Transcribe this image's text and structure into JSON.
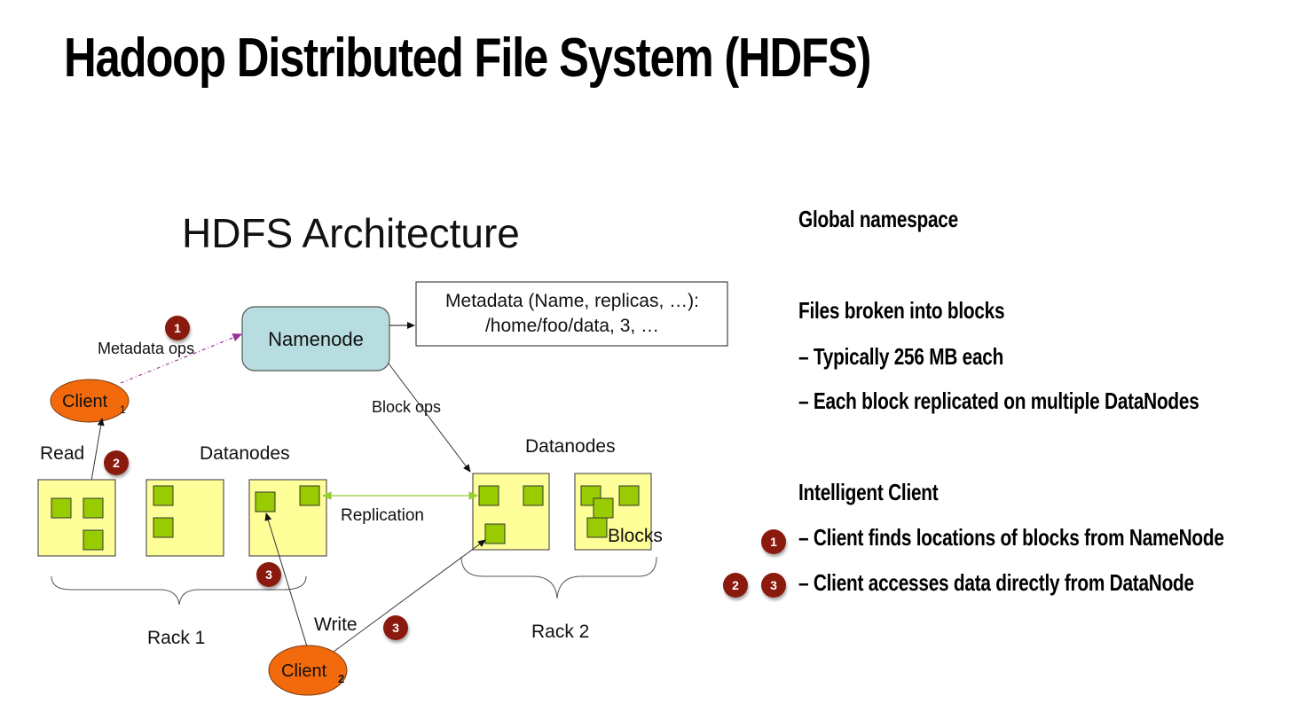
{
  "title": "Hadoop Distributed File System (HDFS)",
  "diagram": {
    "heading": "HDFS Architecture",
    "namenode_label": "Namenode",
    "metadata_box": {
      "line1": "Metadata (Name, replicas, …):",
      "line2": "/home/foo/data, 3, …"
    },
    "metadata_ops_label": "Metadata ops",
    "block_ops_label": "Block ops",
    "client1_label": "Client",
    "client1_sub": "1",
    "client2_label": "Client",
    "client2_sub": "2",
    "read_label": "Read",
    "write_label": "Write",
    "replication_label": "Replication",
    "blocks_label": "Blocks",
    "datanodes_rack1_label": "Datanodes",
    "datanodes_rack2_label": "Datanodes",
    "rack1_label": "Rack 1",
    "rack2_label": "Rack 2",
    "badges": {
      "metadata": "1",
      "read": "2",
      "write_rack1": "3",
      "write_rack2": "3"
    },
    "colors": {
      "namenode_fill": "#b7dde0",
      "client_fill": "#f26a0c",
      "datanode_fill": "#ffff99",
      "block_fill": "#99cc00",
      "replication_arrow": "#99cc33",
      "metadata_arrow": "#993399",
      "badge_fill": "#8b1a0e"
    }
  },
  "bullets": {
    "global_namespace": "Global namespace",
    "files_broken": "Files broken into blocks",
    "typically": "– Typically  256 MB each",
    "replicated": "– Each block replicated on multiple DataNodes",
    "intelligent_client": "Intelligent Client",
    "client_finds": "– Client finds locations of blocks from NameNode",
    "client_accesses": "– Client accesses data directly from DataNode",
    "badge_finds": "1",
    "badge_accesses_a": "2",
    "badge_accesses_b": "3"
  }
}
